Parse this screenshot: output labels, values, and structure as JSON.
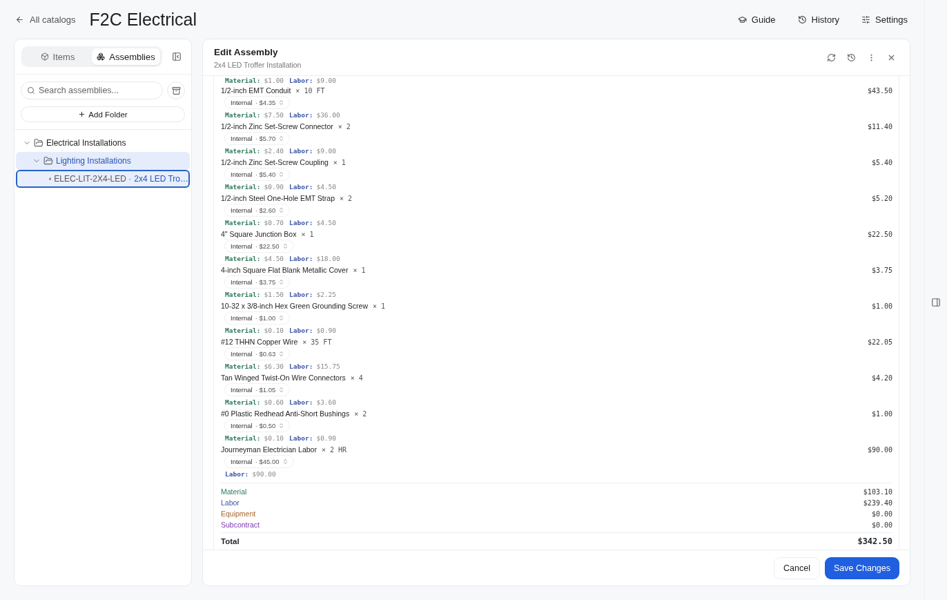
{
  "header": {
    "back_link": "All catalogs",
    "title": "F2C Electrical",
    "actions": [
      {
        "label": "Guide",
        "kind": "guide"
      },
      {
        "label": "History",
        "kind": "history"
      },
      {
        "label": "Settings",
        "kind": "settings"
      }
    ]
  },
  "sidebar": {
    "tabs": [
      {
        "label": "Items",
        "kind": "items",
        "selected": false
      },
      {
        "label": "Assemblies",
        "kind": "assemblies",
        "selected": true
      }
    ],
    "search": {
      "placeholder": "Search assemblies..."
    },
    "add_folder": "Add Folder",
    "tree": [
      {
        "label": "Electrical Installations",
        "kind": "folder",
        "expanded": true,
        "selected": false,
        "children": [
          {
            "label": "Lighting Installations",
            "kind": "folder",
            "expanded": true,
            "selected": false,
            "highlighted": true,
            "children": [
              {
                "kind": "assembly",
                "code": "ELEC-LIT-2X4-LED ·",
                "label": "2x4 LED Tro…",
                "selected": true
              }
            ]
          }
        ]
      }
    ]
  },
  "editor": {
    "title": "Edit Assembly",
    "subtitle": "2x4 LED Troffer Installation",
    "clipped_costs": [
      {
        "kind": "material",
        "label": "Material:",
        "value": "$1.00"
      },
      {
        "kind": "labor",
        "label": "Labor:",
        "value": "$9.00"
      }
    ],
    "items": [
      {
        "name": "1/2-inch EMT Conduit",
        "quantity": "× 10 FT",
        "source": "Internal",
        "price": "· $4.35",
        "total": "$43.50",
        "costs": [
          {
            "kind": "material",
            "label": "Material:",
            "value": "$7.50"
          },
          {
            "kind": "labor",
            "label": "Labor:",
            "value": "$36.00"
          }
        ]
      },
      {
        "name": "1/2-inch Zinc Set-Screw Connector",
        "quantity": "× 2",
        "source": "Internal",
        "price": "· $5.70",
        "total": "$11.40",
        "costs": [
          {
            "kind": "material",
            "label": "Material:",
            "value": "$2.40"
          },
          {
            "kind": "labor",
            "label": "Labor:",
            "value": "$9.00"
          }
        ]
      },
      {
        "name": "1/2-inch Zinc Set-Screw Coupling",
        "quantity": "× 1",
        "source": "Internal",
        "price": "· $5.40",
        "total": "$5.40",
        "costs": [
          {
            "kind": "material",
            "label": "Material:",
            "value": "$0.90"
          },
          {
            "kind": "labor",
            "label": "Labor:",
            "value": "$4.50"
          }
        ]
      },
      {
        "name": "1/2-inch Steel One-Hole EMT Strap",
        "quantity": "× 2",
        "source": "Internal",
        "price": "· $2.60",
        "total": "$5.20",
        "costs": [
          {
            "kind": "material",
            "label": "Material:",
            "value": "$0.70"
          },
          {
            "kind": "labor",
            "label": "Labor:",
            "value": "$4.50"
          }
        ]
      },
      {
        "name": "4\" Square Junction Box",
        "quantity": "× 1",
        "source": "Internal",
        "price": "· $22.50",
        "total": "$22.50",
        "costs": [
          {
            "kind": "material",
            "label": "Material:",
            "value": "$4.50"
          },
          {
            "kind": "labor",
            "label": "Labor:",
            "value": "$18.00"
          }
        ]
      },
      {
        "name": "4-inch Square Flat Blank Metallic Cover",
        "quantity": "× 1",
        "source": "Internal",
        "price": "· $3.75",
        "total": "$3.75",
        "costs": [
          {
            "kind": "material",
            "label": "Material:",
            "value": "$1.50"
          },
          {
            "kind": "labor",
            "label": "Labor:",
            "value": "$2.25"
          }
        ]
      },
      {
        "name": "10-32 x 3/8-inch Hex Green Grounding Screw",
        "quantity": "× 1",
        "source": "Internal",
        "price": "· $1.00",
        "total": "$1.00",
        "costs": [
          {
            "kind": "material",
            "label": "Material:",
            "value": "$0.10"
          },
          {
            "kind": "labor",
            "label": "Labor:",
            "value": "$0.90"
          }
        ]
      },
      {
        "name": "#12 THHN Copper Wire",
        "quantity": "× 35 FT",
        "source": "Internal",
        "price": "· $0.63",
        "total": "$22.05",
        "costs": [
          {
            "kind": "material",
            "label": "Material:",
            "value": "$6.30"
          },
          {
            "kind": "labor",
            "label": "Labor:",
            "value": "$15.75"
          }
        ]
      },
      {
        "name": "Tan Winged Twist-On Wire Connectors",
        "quantity": "× 4",
        "source": "Internal",
        "price": "· $1.05",
        "total": "$4.20",
        "costs": [
          {
            "kind": "material",
            "label": "Material:",
            "value": "$0.60"
          },
          {
            "kind": "labor",
            "label": "Labor:",
            "value": "$3.60"
          }
        ]
      },
      {
        "name": "#0 Plastic Redhead Anti-Short Bushings",
        "quantity": "× 2",
        "source": "Internal",
        "price": "· $0.50",
        "total": "$1.00",
        "costs": [
          {
            "kind": "material",
            "label": "Material:",
            "value": "$0.10"
          },
          {
            "kind": "labor",
            "label": "Labor:",
            "value": "$0.90"
          }
        ]
      },
      {
        "name": "Journeyman Electrician Labor",
        "quantity": "× 2 HR",
        "source": "Internal",
        "price": "· $45.00",
        "total": "$90.00",
        "costs": [
          {
            "kind": "labor",
            "label": "Labor:",
            "value": "$90.00"
          }
        ]
      }
    ],
    "summary": [
      {
        "kind": "material",
        "label": "Material",
        "value": "$103.10"
      },
      {
        "kind": "labor",
        "label": "Labor",
        "value": "$239.40"
      },
      {
        "kind": "equipment",
        "label": "Equipment",
        "value": "$0.00"
      },
      {
        "kind": "subcontract",
        "label": "Subcontract",
        "value": "$0.00"
      }
    ],
    "total": {
      "label": "Total",
      "value": "$342.50"
    },
    "buttons": [
      {
        "label": "Cancel",
        "kind": "secondary"
      },
      {
        "label": "Save Changes",
        "kind": "primary"
      }
    ]
  }
}
